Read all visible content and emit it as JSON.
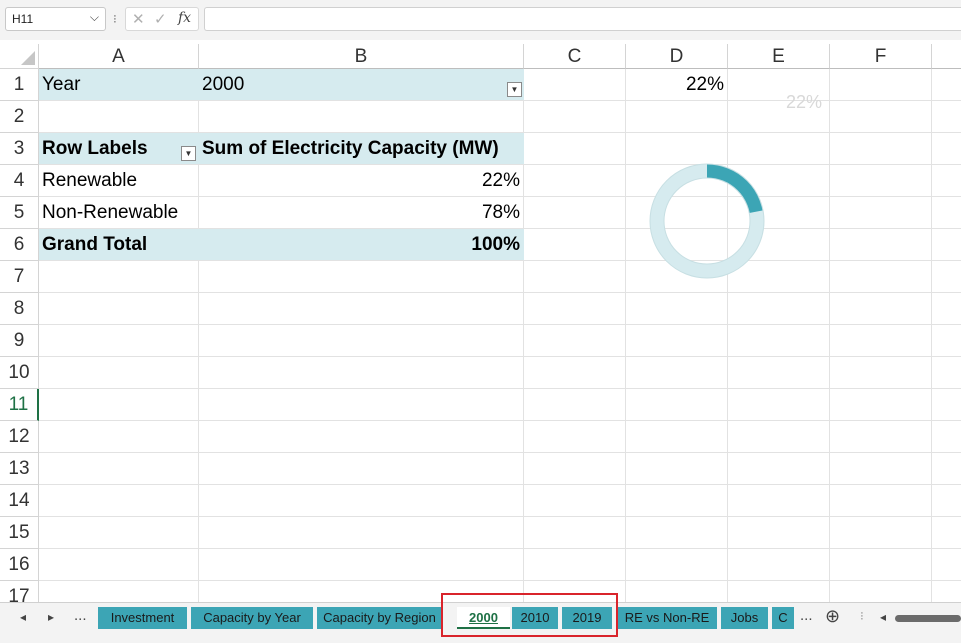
{
  "formula_bar": {
    "name_box": "H11",
    "name_box_chevron": "⌵",
    "separator": "⁝",
    "cancel_glyph": "✕",
    "enter_glyph": "✓",
    "fx_label": "fx",
    "formula": ""
  },
  "columns": [
    "A",
    "B",
    "C",
    "D",
    "E",
    "F"
  ],
  "rows": [
    "1",
    "2",
    "3",
    "4",
    "5",
    "6",
    "7",
    "8",
    "9",
    "10",
    "11",
    "12",
    "13",
    "14",
    "15",
    "16",
    "17"
  ],
  "pivot": {
    "filter_label": "Year",
    "filter_value": "2000",
    "header_row_labels": "Row Labels",
    "header_value": "Sum of Electricity Capacity (MW)",
    "rows": [
      {
        "label": "Renewable",
        "value": "22%"
      },
      {
        "label": "Non-Renewable",
        "value": "78%"
      }
    ],
    "total_label": "Grand Total",
    "total_value": "100%"
  },
  "cell_d1": "22%",
  "chart": {
    "type": "donut",
    "label": "22%",
    "renewable_share": 0.22,
    "colors": {
      "filled": "#3ca5b5",
      "remaining": "#d6ebef"
    }
  },
  "colors": {
    "pivot_band": "#d6ebef",
    "tab_fill": "#3ca5b5",
    "active_accent": "#1e7145",
    "highlight_box": "#d9242b"
  },
  "tabs": {
    "prev_arrow": "◂",
    "next_arrow": "▸",
    "more_left": "...",
    "more_right": "...",
    "add_icon": "⊕",
    "options_glyph": "⁝",
    "scroll_left_arrow": "◂",
    "items": [
      {
        "label": "Investment"
      },
      {
        "label": "Capacity by Year"
      },
      {
        "label": "Capacity by Region"
      },
      {
        "label": "2000",
        "active": true
      },
      {
        "label": "2010"
      },
      {
        "label": "2019"
      },
      {
        "label": "RE vs Non-RE"
      },
      {
        "label": "Jobs"
      },
      {
        "label": "C"
      }
    ]
  }
}
